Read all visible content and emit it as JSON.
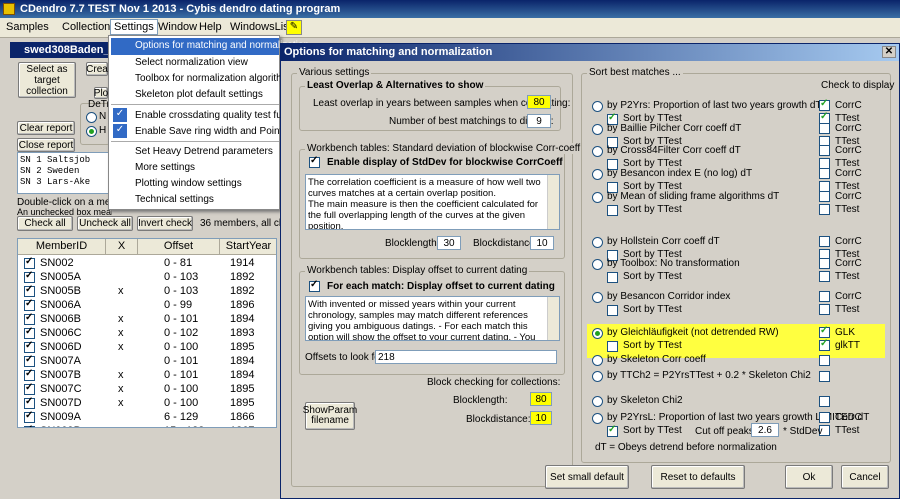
{
  "app": {
    "title": "CDendro 7.7 TEST Nov 1 2013 - Cybis dendro dating program"
  },
  "menu": {
    "samples": "Samples",
    "collections": "Collections",
    "settings": "Settings",
    "window": "Window",
    "help": "Help",
    "windowslist": "WindowsList"
  },
  "inner": {
    "title": "swed308Baden_18",
    "select_target": "Select as target collection",
    "clear_report": "Clear report",
    "close_report": "Close report",
    "btn_crea": "Crea",
    "btn_plo": "Plo",
    "detrend_label": "DeTr",
    "radio_n": "N",
    "radio_h": "H",
    "report_lines": [
      "SN      1  Saltsjob",
      "SN      2  Sweden",
      "SN      3  Lars-Ake"
    ],
    "dblclick_text": "Double-click on a member",
    "unchecked_text": "An unchecked box means that the member does not part in calculations of",
    "check_all": "Check all",
    "uncheck_all": "Uncheck all",
    "invert_check": "Invert check",
    "members_info": "36 members, all chec"
  },
  "table": {
    "headers": [
      "MemberID",
      "X",
      "Offset",
      "StartYear"
    ],
    "rows": [
      {
        "id": "SN002",
        "x": "",
        "offset": "0 - 81",
        "start": "1914"
      },
      {
        "id": "SN005A",
        "x": "",
        "offset": "0 - 103",
        "start": "1892"
      },
      {
        "id": "SN005B",
        "x": "x",
        "offset": "0 - 103",
        "start": "1892"
      },
      {
        "id": "SN006A",
        "x": "",
        "offset": "0 - 99",
        "start": "1896"
      },
      {
        "id": "SN006B",
        "x": "x",
        "offset": "0 - 101",
        "start": "1894"
      },
      {
        "id": "SN006C",
        "x": "x",
        "offset": "0 - 102",
        "start": "1893"
      },
      {
        "id": "SN006D",
        "x": "x",
        "offset": "0 - 100",
        "start": "1895"
      },
      {
        "id": "SN007A",
        "x": "",
        "offset": "0 - 101",
        "start": "1894"
      },
      {
        "id": "SN007B",
        "x": "x",
        "offset": "0 - 101",
        "start": "1894"
      },
      {
        "id": "SN007C",
        "x": "x",
        "offset": "0 - 100",
        "start": "1895"
      },
      {
        "id": "SN007D",
        "x": "x",
        "offset": "0 - 100",
        "start": "1895"
      },
      {
        "id": "SN009A",
        "x": "",
        "offset": "6 - 129",
        "start": "1866"
      },
      {
        "id": "SN009B",
        "x": "x",
        "offset": "15 - 128",
        "start": "1867"
      }
    ]
  },
  "settings_menu": {
    "items": [
      "Options for matching and normalization",
      "Select normalization view",
      "Toolbox for normalization algorithms",
      "Skeleton plot default settings",
      "Enable crossdating quality test functions",
      "Enable Save ring width and PointLabels d",
      "Set Heavy Detrend parameters",
      "More settings",
      "Plotting window settings",
      "Technical settings"
    ]
  },
  "dialog": {
    "title": "Options for matching and normalization",
    "various": "Various settings",
    "least_overlap_title": "Least Overlap & Alternatives to show",
    "least_overlap_label": "Least overlap in years between samples when correlating:",
    "least_overlap_value": "80",
    "num_best_label": "Number of best matchings to display:",
    "num_best_value": "9",
    "workbench1_title": "Workbench tables: Standard deviation of blockwise Corr-coeff",
    "enable_stddev": "Enable display of StdDev for blockwise CorrCoeff",
    "corr_text": "The correlation coefficient is a measure of how well two curves matches at a certain overlap position.\nThe main measure is then the coefficient calculated for the full overlapping length of the curves at the given position.",
    "blocklength_label": "Blocklength:",
    "blocklength_value": "30",
    "blockdistance_label": "Blockdistance:",
    "blockdistance_value": "10",
    "workbench2_title": "Workbench tables: Display offset to current dating",
    "each_match": "For each match: Display offset to current dating",
    "offset_text": "With invented or missed years within your current chronology, samples may match different references giving you ambiguous datings. - For each match this option will show the offset to your current dating. - You may specify one or more offsets that should be",
    "offsets_label": "Offsets to look for:",
    "offsets_value": "218",
    "block_collections_title": "Block checking for collections:",
    "bc_blocklength_label": "Blocklength:",
    "bc_blocklength_value": "80",
    "bc_blockdistance_label": "Blockdistance:",
    "bc_blockdistance_value": "10",
    "showparam": "ShowParam filename",
    "sort_title": "Sort best matches ...",
    "check_display": "Check to display",
    "sort_by_ttest": "Sort by TTest",
    "options": [
      {
        "label": "by P2Yrs: Proportion of last two years growth  dT",
        "d1": "CorrC",
        "d2": "TTest",
        "c1": true,
        "c2": true,
        "sort": true,
        "sel": false
      },
      {
        "label": "by Baillie Pilcher Corr coeff  dT",
        "d1": "CorrC",
        "d2": "TTest",
        "c1": false,
        "c2": false,
        "sort": false,
        "sel": false
      },
      {
        "label": "by Cross84Filter Corr coeff  dT",
        "d1": "CorrC",
        "d2": "TTest",
        "c1": false,
        "c2": false,
        "sort": false,
        "sel": false
      },
      {
        "label": "by Besancon index E (no log)  dT",
        "d1": "CorrC",
        "d2": "TTest",
        "c1": false,
        "c2": false,
        "sort": false,
        "sel": false
      },
      {
        "label": "by Mean of sliding frame algorithms  dT",
        "d1": "CorrC",
        "d2": "TTest",
        "c1": false,
        "c2": false,
        "sort": false,
        "sel": false
      },
      {
        "label": "by Hollstein Corr coeff  dT",
        "d1": "CorrC",
        "d2": "TTest",
        "c1": false,
        "c2": false,
        "sort": false,
        "sel": false
      },
      {
        "label": "by Toolbox: No transformation",
        "d1": "CorrC",
        "d2": "TTest",
        "c1": false,
        "c2": false,
        "sort": false,
        "sel": false
      },
      {
        "label": "by Besancon Corridor index",
        "d1": "CorrC",
        "d2": "TTest",
        "c1": false,
        "c2": false,
        "sort": false,
        "sel": false
      },
      {
        "label": "by Gleichläufigkeit (not detrended RW)",
        "d1": "GLK",
        "d2": "glkTT",
        "c1": true,
        "c2": true,
        "sort": false,
        "sel": true
      },
      {
        "label": "by Skeleton Corr coeff",
        "d1": "",
        "d2": "",
        "c1": false,
        "c2": false,
        "sort": false,
        "sel": false
      },
      {
        "label": "by TTCh2 = P2YrsTTest + 0.2 * Skeleton Chi2",
        "d1": "",
        "d2": "",
        "c1": false,
        "c2": false,
        "sort": false,
        "sel": false
      },
      {
        "label": "by Skeleton Chi2",
        "d1": "",
        "d2": "",
        "c1": false,
        "c2": false,
        "sort": false,
        "sel": false
      },
      {
        "label": "by P2YrsL: Proportion of last two years growth LIMITED  dT",
        "d1": "CorrC",
        "d2": "TTest",
        "c1": false,
        "c2": false,
        "sort": true,
        "sel": false
      }
    ],
    "cut_off_label": "Cut off peaks at",
    "cut_off_value": "2.6",
    "stddev_label": "* StdDev",
    "dt_note": "dT = Obeys detrend before normalization",
    "set_small": "Set small default",
    "reset_defaults": "Reset to defaults",
    "ok": "Ok",
    "cancel": "Cancel"
  }
}
